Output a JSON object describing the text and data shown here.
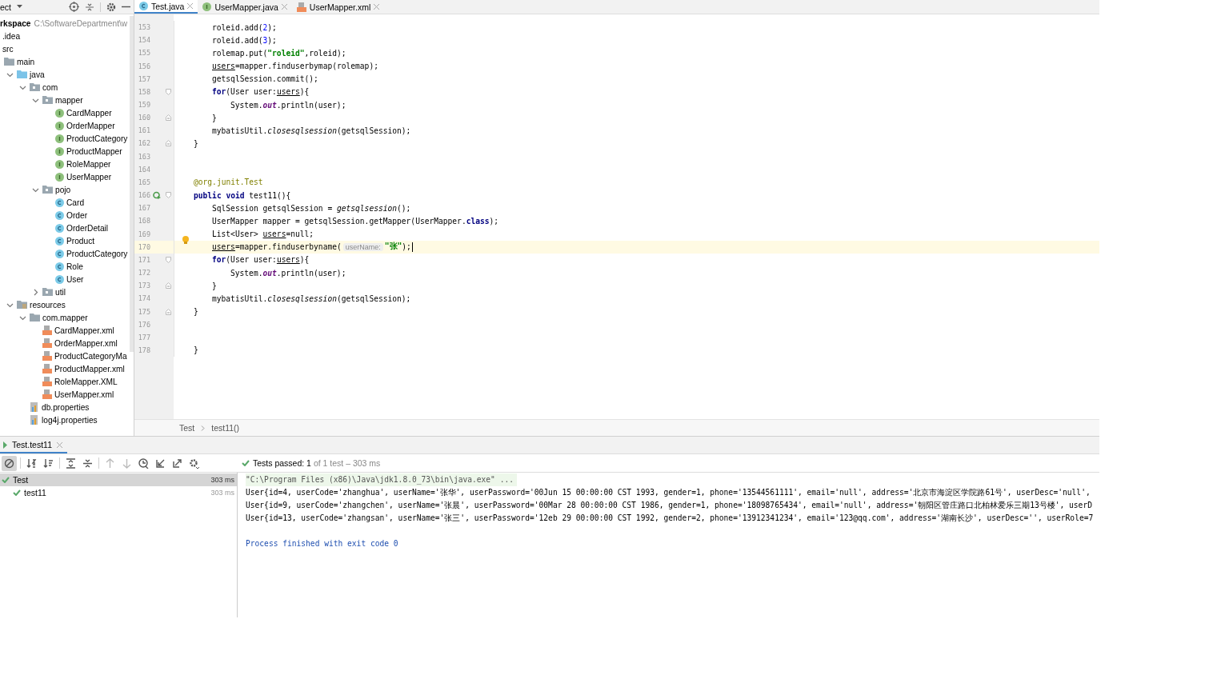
{
  "project": {
    "title": "ect",
    "root": {
      "name": "rkspace",
      "path": "C:\\SoftwareDepartment\\w"
    },
    "items": [
      {
        "name": ".idea"
      },
      {
        "name": "src",
        "children": [
          {
            "name": "main",
            "kind": "folder",
            "children": [
              {
                "name": "java",
                "kind": "source",
                "expanded": true,
                "children": [
                  {
                    "name": "com",
                    "kind": "package",
                    "expanded": true,
                    "children": [
                      {
                        "name": "mapper",
                        "kind": "package",
                        "expanded": true,
                        "children": [
                          {
                            "name": "CardMapper",
                            "kind": "interface"
                          },
                          {
                            "name": "OrderMapper",
                            "kind": "interface"
                          },
                          {
                            "name": "ProductCategory",
                            "kind": "interface"
                          },
                          {
                            "name": "ProductMapper",
                            "kind": "interface"
                          },
                          {
                            "name": "RoleMapper",
                            "kind": "interface"
                          },
                          {
                            "name": "UserMapper",
                            "kind": "interface"
                          }
                        ]
                      },
                      {
                        "name": "pojo",
                        "kind": "package",
                        "expanded": true,
                        "children": [
                          {
                            "name": "Card",
                            "kind": "class"
                          },
                          {
                            "name": "Order",
                            "kind": "class"
                          },
                          {
                            "name": "OrderDetail",
                            "kind": "class"
                          },
                          {
                            "name": "Product",
                            "kind": "class"
                          },
                          {
                            "name": "ProductCategory",
                            "kind": "class"
                          },
                          {
                            "name": "Role",
                            "kind": "class"
                          },
                          {
                            "name": "User",
                            "kind": "class"
                          }
                        ]
                      },
                      {
                        "name": "util",
                        "kind": "package",
                        "expanded": false
                      }
                    ]
                  }
                ]
              },
              {
                "name": "resources",
                "kind": "resources",
                "expanded": true,
                "children": [
                  {
                    "name": "com.mapper",
                    "kind": "folder",
                    "expanded": true,
                    "children": [
                      {
                        "name": "CardMapper.xml",
                        "kind": "xml"
                      },
                      {
                        "name": "OrderMapper.xml",
                        "kind": "xml"
                      },
                      {
                        "name": "ProductCategoryMa",
                        "kind": "xml"
                      },
                      {
                        "name": "ProductMapper.xml",
                        "kind": "xml"
                      },
                      {
                        "name": "RoleMapper.XML",
                        "kind": "xml"
                      },
                      {
                        "name": "UserMapper.xml",
                        "kind": "xml"
                      }
                    ]
                  },
                  {
                    "name": "db.properties",
                    "kind": "properties"
                  },
                  {
                    "name": "log4j.properties",
                    "kind": "properties"
                  }
                ]
              }
            ]
          }
        ]
      }
    ]
  },
  "editor": {
    "tabs": [
      {
        "label": "Test.java",
        "kind": "class",
        "selected": true
      },
      {
        "label": "UserMapper.java",
        "kind": "interface",
        "selected": false
      },
      {
        "label": "UserMapper.xml",
        "kind": "xml",
        "selected": false
      }
    ],
    "lines": [
      {
        "children": [
          {
            "n": "153",
            "tokens": [
              {
                "kind": "p",
                "text": "roleid.add("
              },
              {
                "kind": "num",
                "text": "2"
              },
              {
                "kind": "p",
                "text": ");"
              }
            ]
          },
          {
            "n": "154",
            "tokens": [
              {
                "kind": "p",
                "text": "roleid.add("
              },
              {
                "kind": "num",
                "text": "3"
              },
              {
                "kind": "p",
                "text": ");"
              }
            ]
          },
          {
            "n": "155",
            "tokens": [
              {
                "kind": "p",
                "text": "rolemap.put("
              },
              {
                "kind": "str",
                "text": "\"roleid\""
              },
              {
                "kind": "p",
                "text": ",roleid);"
              }
            ]
          },
          {
            "n": "156",
            "tokens": [
              {
                "kind": "ul",
                "text": "users"
              },
              {
                "kind": "p",
                "text": "=mapper.finduserbymap(rolemap);"
              }
            ]
          },
          {
            "n": "157",
            "tokens": [
              {
                "kind": "p",
                "text": "getsqlSession.commit();"
              }
            ]
          },
          {
            "n": "158",
            "kind": "fold-start",
            "tokens": [
              {
                "kind": "kw",
                "text": "for"
              },
              {
                "kind": "p",
                "text": "(User user:"
              },
              {
                "kind": "ul",
                "text": "users"
              },
              {
                "kind": "p",
                "text": "){"
              }
            ],
            "children": [
              {
                "n": "159",
                "tokens": [
                  {
                    "kind": "p",
                    "text": "System."
                  },
                  {
                    "kind": "field",
                    "text": "out"
                  },
                  {
                    "kind": "p",
                    "text": ".println(user);"
                  }
                ]
              }
            ]
          },
          {
            "n": "160",
            "kind": "fold-end",
            "tokens": [
              {
                "kind": "p",
                "text": "}"
              }
            ]
          },
          {
            "n": "161",
            "tokens": [
              {
                "kind": "p",
                "text": "mybatisUtil."
              },
              {
                "kind": "ital",
                "text": "closesqlsession"
              },
              {
                "kind": "p",
                "text": "(getsqlSession);"
              }
            ]
          }
        ]
      },
      {
        "n": "162",
        "kind": "fold-end",
        "tokens": [
          {
            "kind": "p",
            "text": "}"
          }
        ]
      },
      {
        "n": "163"
      },
      {
        "n": "164"
      },
      {
        "n": "165",
        "tokens": [
          {
            "kind": "ann",
            "text": "@org.junit.Test"
          }
        ]
      },
      {
        "n": "166",
        "kind": "fold-start",
        "run": true,
        "tokens": [
          {
            "kind": "kw",
            "text": "public void"
          },
          {
            "kind": "p",
            "text": " test11(){"
          }
        ],
        "children": [
          {
            "n": "167",
            "tokens": [
              {
                "kind": "p",
                "text": "SqlSession getsqlSession = "
              },
              {
                "kind": "ital",
                "text": "getsqlsession"
              },
              {
                "kind": "p",
                "text": "();"
              }
            ]
          },
          {
            "n": "168",
            "tokens": [
              {
                "kind": "p",
                "text": "UserMapper mapper = getsqlSession.getMapper(UserMapper."
              },
              {
                "kind": "kw",
                "text": "class"
              },
              {
                "kind": "p",
                "text": ");"
              }
            ]
          },
          {
            "n": "169",
            "tokens": [
              {
                "kind": "p",
                "text": "List<User> "
              },
              {
                "kind": "ul",
                "text": "users"
              },
              {
                "kind": "p",
                "text": "=null;"
              }
            ]
          },
          {
            "n": "170",
            "current": true,
            "tokens": [
              {
                "kind": "ul",
                "text": "users"
              },
              {
                "kind": "p",
                "text": "=mapper.finduserbyname("
              },
              {
                "kind": "hint",
                "text": "userName:"
              },
              {
                "kind": "str",
                "text": "\"张\""
              },
              {
                "kind": "p",
                "text": ");"
              }
            ]
          },
          {
            "n": "171",
            "kind": "fold-start",
            "tokens": [
              {
                "kind": "kw",
                "text": "for"
              },
              {
                "kind": "p",
                "text": "(User user:"
              },
              {
                "kind": "ul",
                "text": "users"
              },
              {
                "kind": "p",
                "text": "){"
              }
            ],
            "children": [
              {
                "n": "172",
                "tokens": [
                  {
                    "kind": "p",
                    "text": "System."
                  },
                  {
                    "kind": "field",
                    "text": "out"
                  },
                  {
                    "kind": "p",
                    "text": ".println(user);"
                  }
                ]
              }
            ]
          },
          {
            "n": "173",
            "kind": "fold-end",
            "tokens": [
              {
                "kind": "p",
                "text": "}"
              }
            ]
          },
          {
            "n": "174",
            "tokens": [
              {
                "kind": "p",
                "text": "mybatisUtil."
              },
              {
                "kind": "ital",
                "text": "closesqlsession"
              },
              {
                "kind": "p",
                "text": "(getsqlSession);"
              }
            ]
          }
        ]
      },
      {
        "n": "175",
        "kind": "fold-end",
        "tokens": [
          {
            "kind": "p",
            "text": "}"
          }
        ]
      },
      {
        "n": "176"
      },
      {
        "n": "177"
      },
      {
        "n": "178",
        "tokens": [
          {
            "kind": "p",
            "text": "}"
          }
        ]
      }
    ],
    "breadcrumb": [
      "Test",
      "test11()"
    ]
  },
  "run": {
    "tab": "Test.test11",
    "toolbar": [
      {
        "kind": "cancel",
        "selected": true,
        "disabled": false
      },
      {
        "kind": "sort-alpha",
        "selected": false,
        "disabled": false
      },
      {
        "kind": "sort-time",
        "selected": false,
        "disabled": false
      },
      {
        "kind": "expand",
        "selected": false,
        "disabled": false
      },
      {
        "kind": "collapse",
        "selected": false,
        "disabled": false
      },
      {
        "kind": "up",
        "selected": false,
        "disabled": true
      },
      {
        "kind": "down",
        "selected": false,
        "disabled": true
      },
      {
        "kind": "history",
        "selected": false,
        "disabled": false
      },
      {
        "kind": "import",
        "selected": false,
        "disabled": false
      },
      {
        "kind": "export",
        "selected": false,
        "disabled": false
      },
      {
        "kind": "settings",
        "selected": false,
        "disabled": false
      }
    ],
    "summary": {
      "label": "Tests passed:",
      "count": "1",
      "detail": "of 1 test – 303 ms"
    },
    "tests": [
      {
        "name": "Test",
        "time": "303 ms",
        "passed": true,
        "selected": true,
        "children": [
          {
            "name": "test11",
            "time": "303 ms",
            "passed": true,
            "selected": false
          }
        ]
      }
    ],
    "console": [
      {
        "kind": "cmd",
        "text": "\"C:\\Program Files (x86)\\Java\\jdk1.8.0_73\\bin\\java.exe\" ..."
      },
      {
        "kind": "out",
        "text": "User{id=4, userCode='zhanghua', userName='张华', userPassword='00Jun 15 00:00:00 CST 1993, gender=1, phone='13544561111', email='null', address='北京市海淀区学院路61号', userDesc='null',"
      },
      {
        "kind": "out",
        "text": "User{id=9, userCode='zhangchen', userName='张晨', userPassword='00Mar 28 00:00:00 CST 1986, gender=1, phone='18098765434', email='null', address='朝阳区管庄路口北柏林爱乐三期13号楼', userD"
      },
      {
        "kind": "out",
        "text": "User{id=13, userCode='zhangsan', userName='张三', userPassword='12eb 29 00:00:00 CST 1992, gender=2, phone='13912341234', email='123@qq.com', address='湖南长沙', userDesc='', userRole=7"
      },
      {
        "kind": "exit",
        "text": "Process finished with exit code 0"
      }
    ]
  }
}
